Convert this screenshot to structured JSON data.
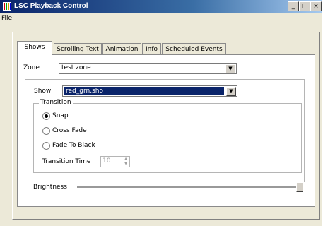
{
  "window": {
    "title": "LSC Playback Control",
    "minimize": "_",
    "maximize": "□",
    "close": "×"
  },
  "menu": {
    "file": "File"
  },
  "tabs": [
    {
      "label": "Shows"
    },
    {
      "label": "Scrolling Text"
    },
    {
      "label": "Animation"
    },
    {
      "label": "Info"
    },
    {
      "label": "Scheduled Events"
    }
  ],
  "zone": {
    "label": "Zone",
    "value": "test zone"
  },
  "show": {
    "label": "Show",
    "value": "red_grn.sho"
  },
  "transition": {
    "group_label": "Transition",
    "options": [
      "Snap",
      "Cross Fade",
      "Fade To Black"
    ],
    "selected": "Snap",
    "time_label": "Transition Time",
    "time_value": "10"
  },
  "brightness": {
    "label": "Brightness",
    "level": 1.0
  }
}
